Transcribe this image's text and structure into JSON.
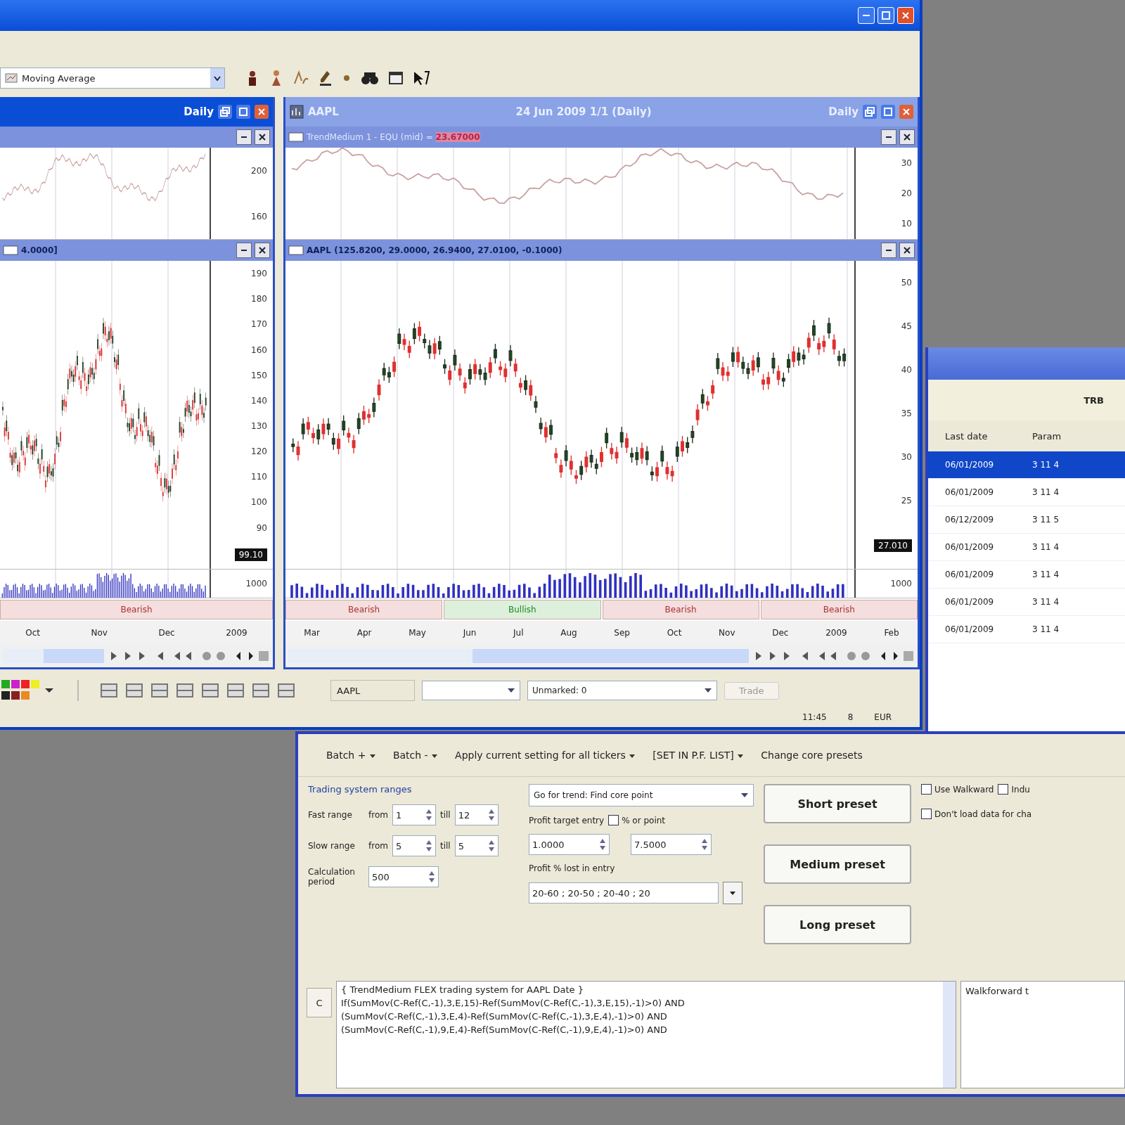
{
  "main_window": {
    "toolbar": {
      "indicator_dropdown": "Moving Average"
    },
    "panes": [
      {
        "selected": true,
        "period": "Daily",
        "indicator": {
          "axis": [
            "200",
            "160"
          ]
        },
        "price": {
          "header": "4.0000]",
          "axis": [
            "190",
            "180",
            "170",
            "160",
            "150",
            "140",
            "130",
            "120",
            "110",
            "100",
            "90"
          ],
          "last": "99.10"
        },
        "volume_label": "1000",
        "patterns": [
          {
            "label": "Bearish",
            "kind": "bearish"
          }
        ],
        "months": [
          "Oct",
          "Nov",
          "Dec",
          "2009"
        ]
      },
      {
        "selected": false,
        "symbol": "AAPL",
        "caption": "24 Jun 2009 1/1 (Daily)",
        "period": "Daily",
        "indicator": {
          "header": "TrendMedium 1 - EQU (mid) =",
          "value": "23.67000",
          "axis": [
            "30",
            "20",
            "10"
          ]
        },
        "price": {
          "header": "AAPL (125.8200, 29.0000, 26.9400, 27.0100, -0.1000)",
          "axis": [
            "50",
            "45",
            "40",
            "35",
            "30",
            "25"
          ],
          "last": "27.010"
        },
        "volume_label": "1000",
        "patterns": [
          {
            "label": "Bearish",
            "kind": "bearish"
          },
          {
            "label": "Bullish",
            "kind": "bullish"
          },
          {
            "label": "Bearish",
            "kind": "bearish"
          },
          {
            "label": "Bearish",
            "kind": "bearish"
          }
        ],
        "months": [
          "Mar",
          "Apr",
          "May",
          "Jun",
          "Jul",
          "Aug",
          "Sep",
          "Oct",
          "Nov",
          "Dec",
          "2009",
          "Feb"
        ]
      }
    ],
    "bottom_toolbar": {
      "ticker": "AAPL",
      "filter_dropdown": "Unmarked: 0",
      "button": "Trade"
    },
    "status_bar": [
      "11:45",
      "8",
      "EUR"
    ]
  },
  "list_window": {
    "filter": "TRB",
    "columns": [
      "Last date",
      "Param"
    ],
    "rows": [
      {
        "selected": true,
        "date": "06/01/2009",
        "param": "3 11 4"
      },
      {
        "selected": false,
        "date": "06/01/2009",
        "param": "3 11 4"
      },
      {
        "selected": false,
        "date": "06/12/2009",
        "param": "3 11 5"
      },
      {
        "selected": false,
        "date": "06/01/2009",
        "param": "3 11 4"
      },
      {
        "selected": false,
        "date": "06/01/2009",
        "param": "3 11 4"
      },
      {
        "selected": false,
        "date": "06/01/2009",
        "param": "3 11 4"
      },
      {
        "selected": false,
        "date": "06/01/2009",
        "param": "3 11 4"
      }
    ]
  },
  "dialog": {
    "menu": [
      "Batch +",
      "Batch -",
      "Apply current setting for all tickers",
      "[SET IN P.F. LIST]"
    ],
    "menu_link": "Change core presets",
    "group_title": "Trading system ranges",
    "fast": {
      "label": "Fast range",
      "from_label": "from",
      "from": "1",
      "till_label": "till",
      "till": "12"
    },
    "slow": {
      "label": "Slow range",
      "from_label": "from",
      "from": "5",
      "till_label": "till",
      "till": "5"
    },
    "period": {
      "label": "Calculation period",
      "value": "500"
    },
    "mode_dropdown": "Go for trend: Find core point",
    "profit_label": "Profit target entry",
    "profit_checkbox": {
      "label": "% or point",
      "checked": false
    },
    "profit_values": [
      "1.0000",
      "7.5000"
    ],
    "lost_label": "Profit % lost in entry",
    "lost_value": "20-60 ; 20-50 ; 20-40 ; 20",
    "presets": [
      "Short preset",
      "Medium preset",
      "Long preset"
    ],
    "options": [
      {
        "label": "Use Walkward",
        "checked": false
      },
      {
        "label": "Indu",
        "checked": false
      },
      {
        "label": "Don't load data for cha",
        "checked": false
      }
    ],
    "code_button": "C",
    "code": [
      "{ TrendMedium FLEX trading system for AAPL Date }",
      "If(SumMov(C-Ref(C,-1),3,E,15)-Ref(SumMov(C-Ref(C,-1),3,E,15),-1)>0) AND",
      "(SumMov(C-Ref(C,-1),3,E,4)-Ref(SumMov(C-Ref(C,-1),3,E,4),-1)>0) AND",
      "(SumMov(C-Ref(C,-1),9,E,4)-Ref(SumMov(C-Ref(C,-1),9,E,4),-1)>0) AND"
    ],
    "side_text": "Walkforward t"
  }
}
